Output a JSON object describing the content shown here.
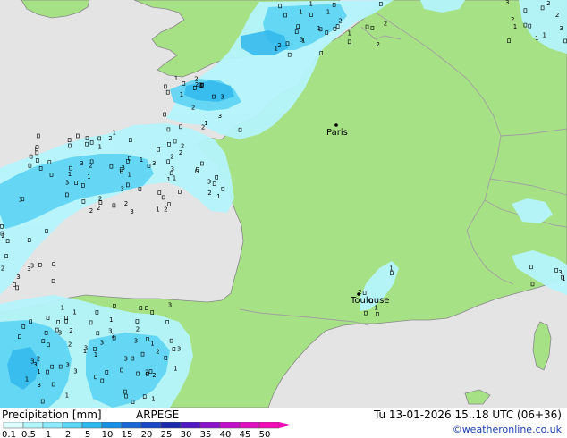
{
  "map": {
    "cities": [
      {
        "name": "Paris",
        "dot": [
          376,
          140
        ],
        "label": [
          365,
          143
        ]
      },
      {
        "name": "Toulouse",
        "dot": [
          401,
          329
        ],
        "label": [
          392,
          331
        ]
      }
    ],
    "colors": {
      "sea": "#e4e4e4",
      "land": "#a6e285",
      "border": "#a0a0a0",
      "coast": "#888888"
    }
  },
  "footer": {
    "title": "Precipitation [mm]",
    "model": "ARPEGE",
    "time": "Tu 13-01-2026 15..18 UTC (06+36)",
    "credit": "©weatheronline.co.uk"
  },
  "legend": {
    "labels": [
      "0.1",
      "0.5",
      "1",
      "2",
      "5",
      "10",
      "15",
      "20",
      "25",
      "30",
      "35",
      "40",
      "45",
      "50"
    ],
    "colors": [
      "#dcfcff",
      "#b4f4fc",
      "#8ce8fa",
      "#5cd4f4",
      "#30b8ec",
      "#1a8ee0",
      "#1a66d2",
      "#1a46c0",
      "#1c2aa8",
      "#5018c0",
      "#8a14c8",
      "#c010c8",
      "#e010c0",
      "#f20ab4"
    ]
  }
}
